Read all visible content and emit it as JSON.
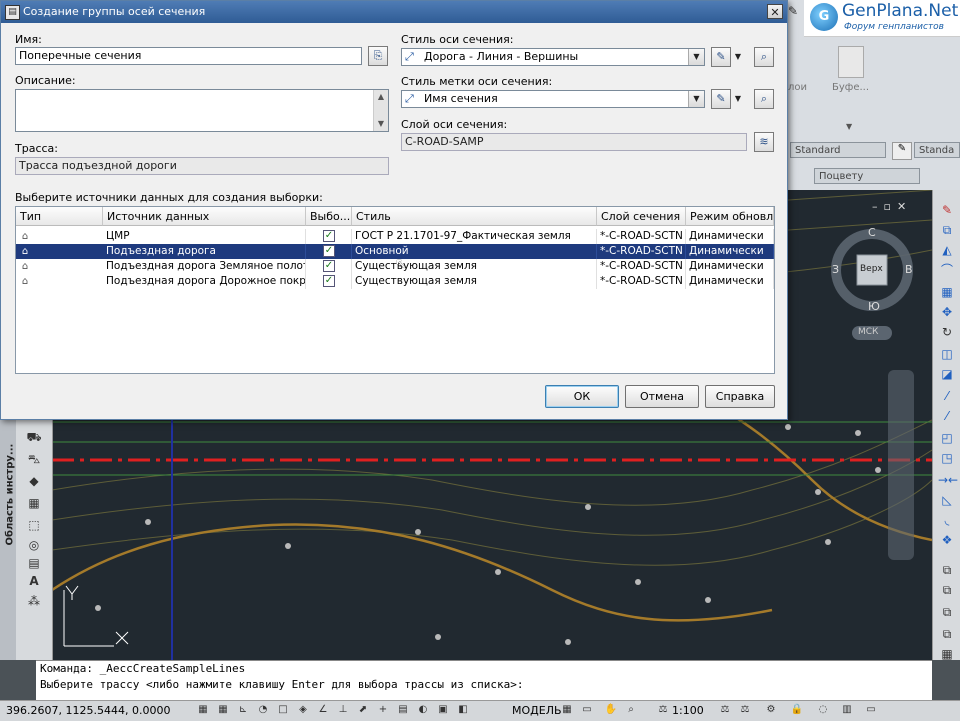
{
  "dialog": {
    "title": "Создание группы осей сечения",
    "close_glyph": "✕",
    "name_label": "Имя:",
    "name_value": "Поперечные сечения",
    "description_label": "Описание:",
    "alignment_label": "Трасса:",
    "alignment_value": "Трасса подъездной дороги",
    "sample_line_style_label": "Стиль оси сечения:",
    "sample_line_style_value": "Дорога - Линия - Вершины",
    "label_style_label": "Стиль метки оси сечения:",
    "label_style_value": "Имя сечения",
    "layer_label": "Слой оси сечения:",
    "layer_value": "C-ROAD-SAMP",
    "sources_label": "Выберите источники данных для создания выборки:",
    "buttons": {
      "ok": "ОК",
      "cancel": "Отмена",
      "help": "Справка"
    }
  },
  "table": {
    "columns": [
      "Тип",
      "Источник данных",
      "Выбо...",
      "Стиль",
      "Слой сечения",
      "Режим обновл..."
    ],
    "rows": [
      {
        "type_icon": "surface-icon",
        "source": "ЦМР",
        "checked": "✓",
        "style": "ГОСТ Р 21.1701-97_Фактическая земля",
        "layer": "*-C-ROAD-SCTN",
        "mode": "Динамически",
        "selected": false
      },
      {
        "type_icon": "corridor-icon",
        "source": "Подъездная дорога",
        "checked": "✓",
        "style": "Основной",
        "layer": "*-C-ROAD-SCTN",
        "mode": "Динамически",
        "selected": true
      },
      {
        "type_icon": "surface-icon",
        "source": "Подъездная дорога Земляное полотно",
        "checked": "✓",
        "style": "Существующая земля",
        "layer": "*-C-ROAD-SCTN",
        "mode": "Динамически",
        "selected": false
      },
      {
        "type_icon": "surface-icon",
        "source": "Подъездная дорога Дорожное покрытие",
        "checked": "✓",
        "style": "Существующая земля",
        "layer": "*-C-ROAD-SCTN",
        "mode": "Динамически",
        "selected": false
      }
    ]
  },
  "ribbon": {
    "item1": "лои",
    "item2": "Буфе...",
    "style_combo1": "Standard",
    "style_combo2": "Standa",
    "layer_combo": "Поцвету"
  },
  "logo": {
    "title": "GenPlana.Net",
    "subtitle": "Форум генпланистов"
  },
  "viewcube": {
    "north": "С",
    "south": "Ю",
    "west": "З",
    "east": "В",
    "top": "Верх",
    "ucs": "МСК"
  },
  "left_palette": {
    "title": "Область инстру..."
  },
  "command_line": {
    "line1": "Команда:  _AeccCreateSampleLines",
    "line2": "Выберите трассу <либо нажмите клавишу Enter для выбора трассы из списка>:"
  },
  "status": {
    "coords": "396.2607, 1125.5444, 0.0000",
    "model": "МОДЕЛЬ",
    "scale": "1:100"
  },
  "colors": {
    "selection": "#1e3a7e",
    "title_bar": "#2f5c95",
    "viewport_bg": "#212930",
    "alignment_line": "#e02020",
    "contour": "#a47a2a"
  }
}
